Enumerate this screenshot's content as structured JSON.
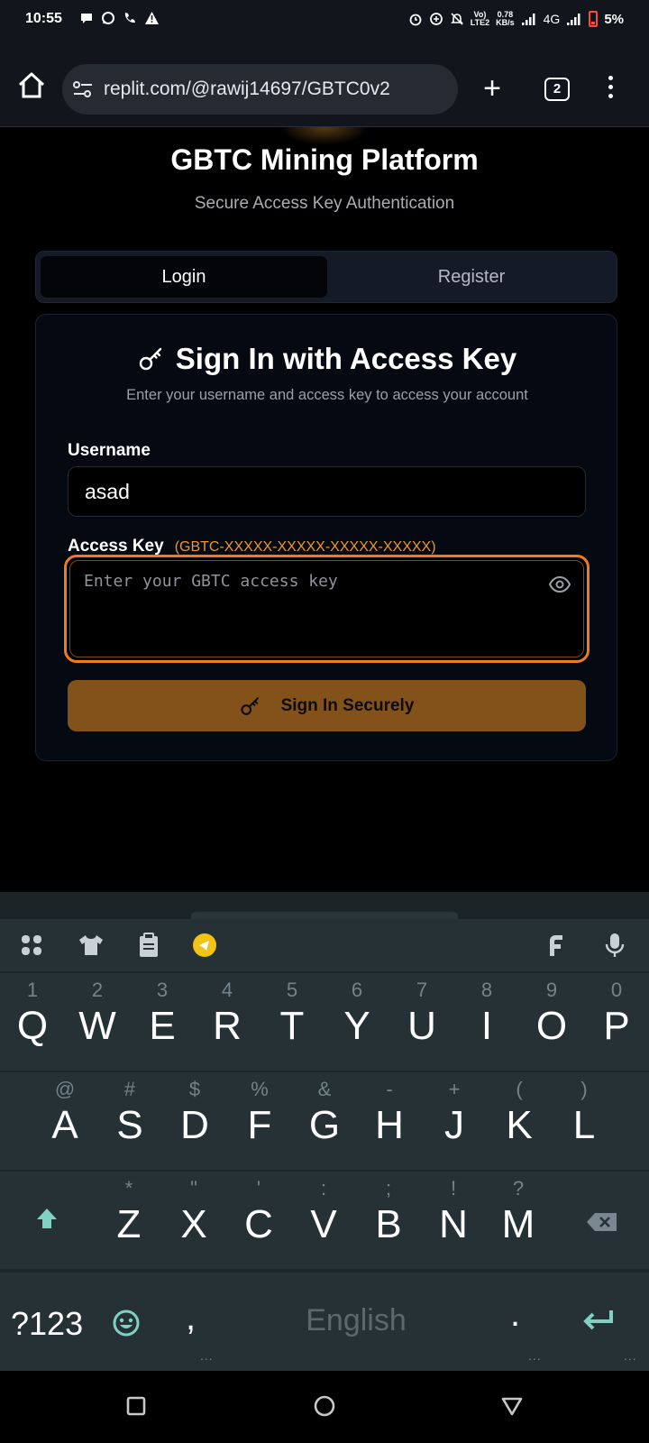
{
  "status_bar": {
    "time": "10:55",
    "net_speed_value": "0.78",
    "net_speed_unit": "KB/s",
    "volte": "Vo)\nLTE2",
    "network": "4G",
    "battery": "5%"
  },
  "browser": {
    "url": "replit.com/@rawij14697/GBTC0v2",
    "tab_count": "2"
  },
  "page": {
    "title": "GBTC Mining Platform",
    "subtitle": "Secure Access Key Authentication",
    "tabs": {
      "login": "Login",
      "register": "Register"
    },
    "card": {
      "title": "Sign In with Access Key",
      "description": "Enter your username and access key to access your account",
      "username_label": "Username",
      "username_value": "asad",
      "access_key_label": "Access Key",
      "access_key_format": "(GBTC-XXXXX-XXXXX-XXXXX-XXXXX)",
      "access_key_placeholder": "Enter your GBTC access key",
      "submit_label": "Sign In Securely"
    }
  },
  "keyboard": {
    "row1": [
      {
        "key": "Q",
        "hint": "1"
      },
      {
        "key": "W",
        "hint": "2"
      },
      {
        "key": "E",
        "hint": "3"
      },
      {
        "key": "R",
        "hint": "4"
      },
      {
        "key": "T",
        "hint": "5"
      },
      {
        "key": "Y",
        "hint": "6"
      },
      {
        "key": "U",
        "hint": "7"
      },
      {
        "key": "I",
        "hint": "8"
      },
      {
        "key": "O",
        "hint": "9"
      },
      {
        "key": "P",
        "hint": "0"
      }
    ],
    "row2": [
      {
        "key": "A",
        "hint": "@"
      },
      {
        "key": "S",
        "hint": "#"
      },
      {
        "key": "D",
        "hint": "$"
      },
      {
        "key": "F",
        "hint": "%"
      },
      {
        "key": "G",
        "hint": "&"
      },
      {
        "key": "H",
        "hint": "-"
      },
      {
        "key": "J",
        "hint": "+"
      },
      {
        "key": "K",
        "hint": "("
      },
      {
        "key": "L",
        "hint": ")"
      }
    ],
    "row3": [
      {
        "key": "Z",
        "hint": "*"
      },
      {
        "key": "X",
        "hint": "\""
      },
      {
        "key": "C",
        "hint": "'"
      },
      {
        "key": "V",
        "hint": ":"
      },
      {
        "key": "B",
        "hint": ";"
      },
      {
        "key": "N",
        "hint": "!"
      },
      {
        "key": "M",
        "hint": "?"
      }
    ],
    "symbols_key": "?123",
    "comma": ",",
    "space_label": "English",
    "period": ".",
    "ellipsis": "..."
  },
  "colors": {
    "accent_orange": "#ee7b22",
    "button_brown": "#83521a",
    "hint_orange": "#f0952c",
    "keyboard_teal": "#7fd1c4"
  }
}
